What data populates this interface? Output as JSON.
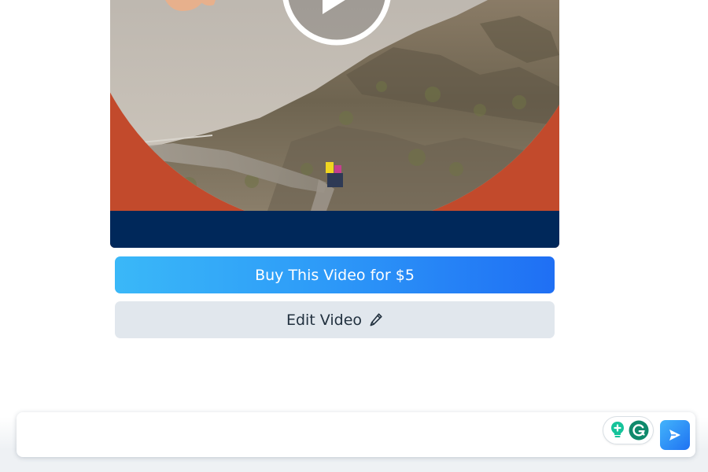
{
  "video": {
    "play_icon": "play-icon",
    "colors": {
      "frame_background": "#c9492a",
      "bottom_bar": "#00285a"
    }
  },
  "actions": {
    "buy_label": "Buy This Video for $5",
    "edit_label": "Edit Video",
    "edit_icon": "pencil-icon",
    "colors": {
      "buy_gradient_start": "#3ab8f8",
      "buy_gradient_end": "#1f6ff4",
      "edit_background": "#e1e7ed"
    }
  },
  "composer": {
    "input_value": "",
    "input_placeholder": "",
    "extension_icons": [
      "grammarly-spark-icon",
      "grammarly-g-icon"
    ],
    "send_icon": "send-arrow-icon",
    "colors": {
      "send_gradient_start": "#43b4fb",
      "send_gradient_end": "#1f72f2",
      "grammarly_green": "#15c39a",
      "grammarly_dark_green": "#0f8a6c"
    }
  }
}
